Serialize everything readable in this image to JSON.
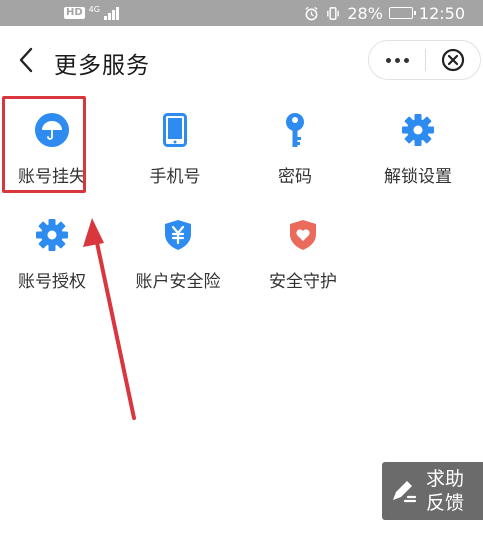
{
  "status_bar": {
    "hd": "HD",
    "network": "4G",
    "battery_percent": "28%",
    "battery_level": 0.28,
    "time": "12:50",
    "icons": [
      "alarm-icon",
      "vibrate-icon",
      "battery-icon",
      "signal-icon"
    ]
  },
  "header": {
    "title": "更多服务",
    "icons": [
      "back-arrow-icon",
      "more-dots-icon",
      "close-circle-icon"
    ]
  },
  "services": [
    {
      "label": "账号挂失",
      "icon": "umbrella-icon",
      "color": "#2e8bf0"
    },
    {
      "label": "手机号",
      "icon": "phone-icon",
      "color": "#2e8bf0"
    },
    {
      "label": "密码",
      "icon": "key-icon",
      "color": "#2e8bf0"
    },
    {
      "label": "解锁设置",
      "icon": "gear-icon",
      "color": "#2e8bf0"
    },
    {
      "label": "账号授权",
      "icon": "gear-icon",
      "color": "#2e8bf0"
    },
    {
      "label": "账户安全险",
      "icon": "yen-shield-icon",
      "color": "#2e8bf0"
    },
    {
      "label": "安全守护",
      "icon": "heart-shield-icon",
      "color": "#ea6a5c"
    }
  ],
  "feedback": {
    "line1": "求助",
    "line2": "反馈",
    "icon": "edit-pen-icon"
  },
  "colors": {
    "accent": "#2e8bf0",
    "highlight": "#d9363e",
    "status_bar_bg": "#a4a4a4",
    "feedback_bg": "#6b6b6b"
  }
}
